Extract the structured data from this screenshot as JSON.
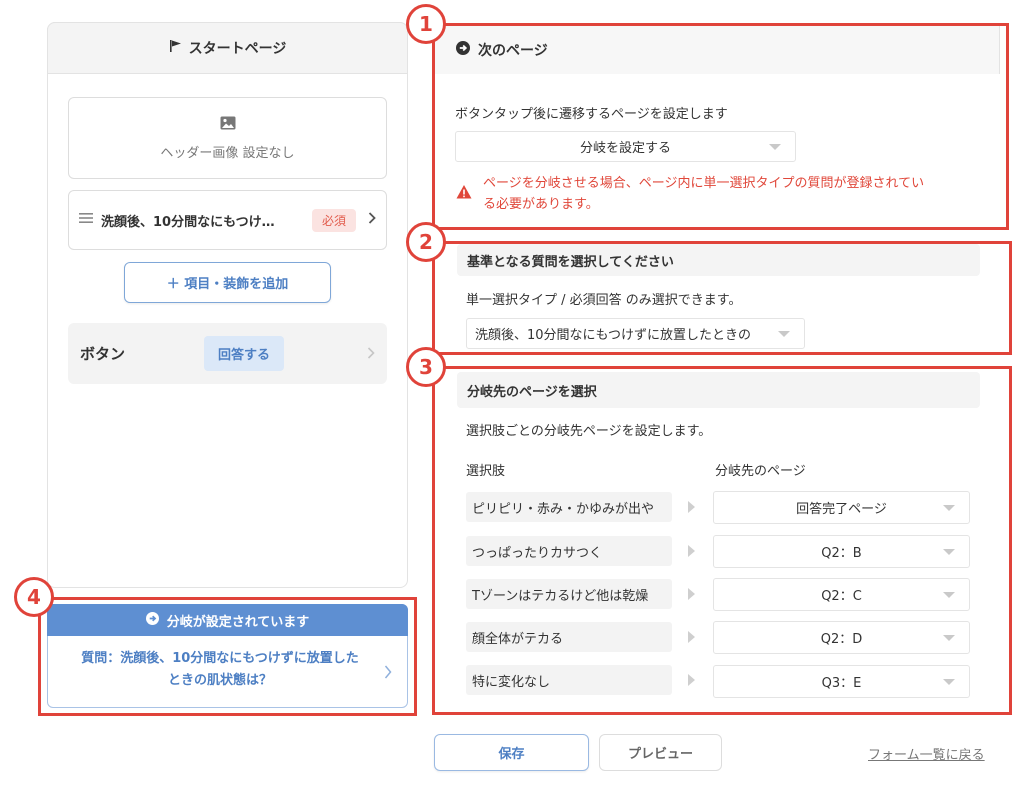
{
  "left": {
    "title": "スタートページ",
    "header_image_label": "ヘッダー画像 設定なし",
    "question_item": {
      "text": "洗顔後、10分間なにもつけ…",
      "badge": "必須"
    },
    "add_button": "＋ 項目・装飾を追加",
    "button_row": {
      "label": "ボタン",
      "answer_button": "回答する"
    }
  },
  "branch_card": {
    "title": "分岐が設定されています",
    "line1": "質問：洗顔後、10分間なにもつけずに放置した",
    "line2": "ときの肌状態は？"
  },
  "next_page": {
    "title": "次のページ",
    "description": "ボタンタップ後に遷移するページを設定します",
    "select_value": "分岐を設定する",
    "warning_line1": "ページを分岐させる場合、ページ内に単一選択タイプの質問が登録されてい",
    "warning_line2": "る必要があります。"
  },
  "base_question": {
    "title": "基準となる質問を選択してください",
    "description": "単一選択タイプ / 必須回答 のみ選択できます。",
    "select_value": "洗顔後、10分間なにもつけずに放置したときの"
  },
  "branch_dest": {
    "title": "分岐先のページを選択",
    "description": "選択肢ごとの分岐先ページを設定します。",
    "col_choice": "選択肢",
    "col_dest": "分岐先のページ",
    "rows": [
      {
        "choice": "ピリピリ・赤み・かゆみが出や",
        "dest": "回答完了ページ"
      },
      {
        "choice": "つっぱったりカサつく",
        "dest": "Q2：B"
      },
      {
        "choice": "Tゾーンはテカるけど他は乾燥",
        "dest": "Q2：C"
      },
      {
        "choice": "顔全体がテカる",
        "dest": "Q2：D"
      },
      {
        "choice": "特に変化なし",
        "dest": "Q3：E"
      }
    ]
  },
  "annotations": [
    "1",
    "2",
    "3",
    "4"
  ],
  "footer": {
    "save": "保存",
    "preview": "プレビュー",
    "back_link": "フォーム一覧に戻る"
  },
  "colors": {
    "accent_blue": "#5e8fd2",
    "annotation_red": "#e0433a",
    "warning_red": "#e0473a",
    "required_badge": "#fbe3e1"
  },
  "icons": [
    "flag-icon",
    "image-icon",
    "menu-icon",
    "chevron-right-icon",
    "arrow-circle-right-icon",
    "warning-icon",
    "chevron-down-icon",
    "triangle-right-icon"
  ]
}
